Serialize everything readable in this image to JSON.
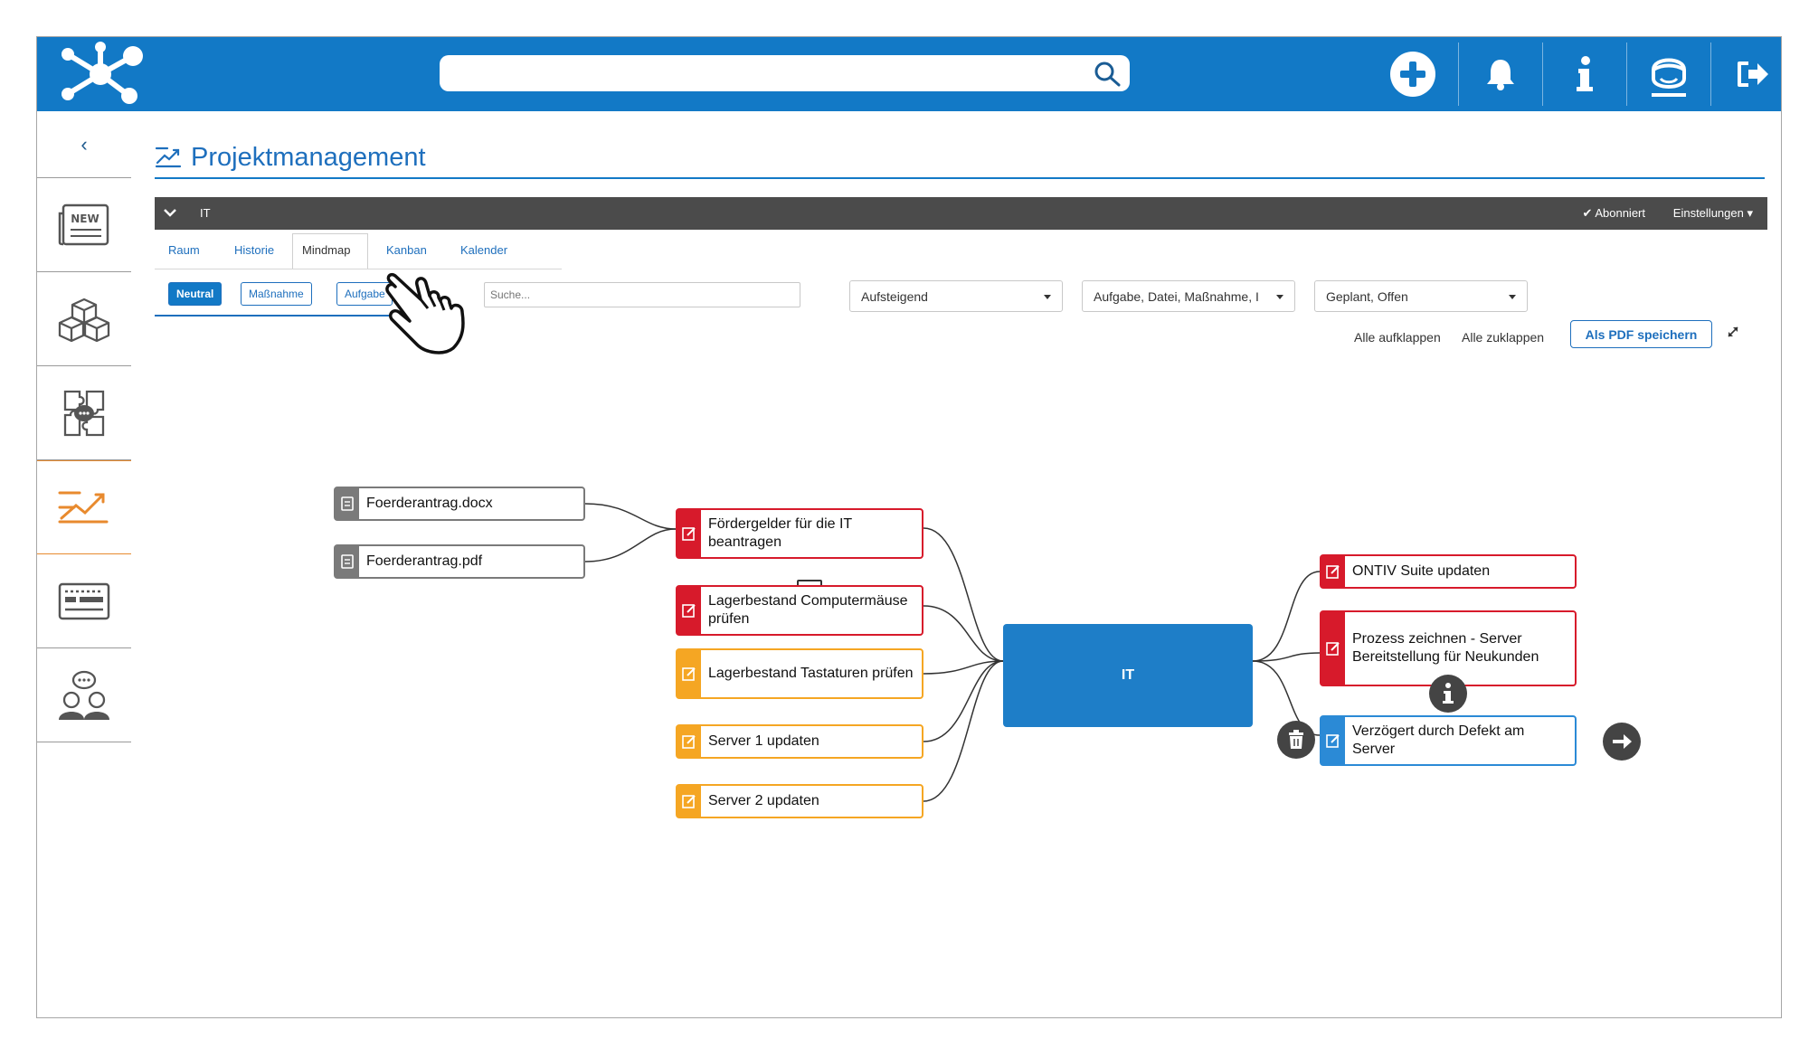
{
  "search": {
    "placeholder": ""
  },
  "page": {
    "title": "Projektmanagement"
  },
  "room_bar": {
    "name": "IT",
    "subscribed": "Abonniert",
    "settings": "Einstellungen"
  },
  "tabs": [
    {
      "label": "Raum"
    },
    {
      "label": "Historie"
    },
    {
      "label": "Mindmap",
      "active": true
    },
    {
      "label": "Kanban"
    },
    {
      "label": "Kalender"
    }
  ],
  "filters": {
    "neutral": "Neutral",
    "massnahme": "Maßnahme",
    "aufgabe": "Aufgabe"
  },
  "mindmap_search": {
    "placeholder": "Suche..."
  },
  "dropdowns": {
    "sort": "Aufsteigend",
    "types": "Aufgabe, Datei, Maßnahme, I",
    "status": "Geplant, Offen"
  },
  "actions": {
    "expand_all": "Alle aufklappen",
    "collapse_all": "Alle zuklappen",
    "save_pdf": "Als PDF speichern"
  },
  "mindmap": {
    "center": "IT",
    "files": [
      "Foerderantrag.docx",
      "Foerderantrag.pdf"
    ],
    "left_nodes": [
      {
        "label": "Fördergelder für die IT beantragen",
        "status": "red"
      },
      {
        "label": "Lagerbestand Computermäuse prüfen",
        "status": "red"
      },
      {
        "label": "Lagerbestand Tastaturen prüfen",
        "status": "orange"
      },
      {
        "label": "Server 1 updaten",
        "status": "orange"
      },
      {
        "label": "Server 2 updaten",
        "status": "orange"
      }
    ],
    "right_nodes": [
      {
        "label": "ONTIV Suite updaten",
        "status": "red"
      },
      {
        "label": "Prozess zeichnen - Server Bereitstellung für Neukunden",
        "status": "red"
      },
      {
        "label": "Verzögert durch Defekt am Server",
        "status": "blue"
      }
    ]
  },
  "colors": {
    "brand": "#1279c6",
    "red": "#d71a2b",
    "orange": "#f5a623",
    "blue": "#2b8ad6",
    "active_nav": "#e88a2e"
  }
}
